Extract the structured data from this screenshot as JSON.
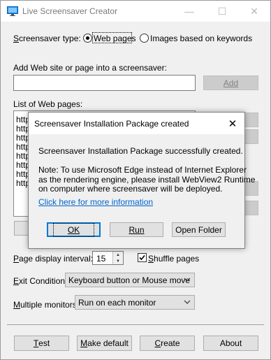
{
  "window": {
    "title": "Live Screensaver Creator",
    "minimize_glyph": "—",
    "maximize_glyph": "☐",
    "close_glyph": "✕",
    "icon": "monitor-icon"
  },
  "type_section": {
    "label": "Screensaver type:",
    "option_web": "Web pages",
    "option_images": "Images based on keywords",
    "selected": "Web pages"
  },
  "add_section": {
    "label": "Add Web site or page into a screensaver:",
    "input_value": "",
    "add_button": "Add"
  },
  "list_section": {
    "label": "List of Web pages:",
    "items": [
      "http",
      "http",
      "http",
      "http",
      "http",
      "http",
      "http",
      "http",
      "http"
    ]
  },
  "settings": {
    "interval_label": "Page display interval:",
    "interval_value": "15",
    "shuffle_label": "Shuffle pages",
    "shuffle_checked": true,
    "exit_label": "Exit Condition:",
    "exit_value": "Keyboard button or Mouse move",
    "monitors_label": "Multiple monitors:",
    "monitors_value": "Run on each monitor"
  },
  "bottom_buttons": {
    "test": "Test",
    "make_default": "Make default",
    "create": "Create",
    "about": "About"
  },
  "dialog": {
    "title": "Screensaver Installation Package created",
    "message": "Screensaver Installation Package successfully created.",
    "note_line1": "Note: To use Microsoft Edge instead of Internet Explorer",
    "note_line2": "as the rendering engine, please install WebView2 Runtime",
    "note_line3": "on computer where screensaver will be deployed.",
    "link": "Click here for more information",
    "ok": "OK",
    "run": "Run",
    "open_folder": "Open Folder"
  }
}
